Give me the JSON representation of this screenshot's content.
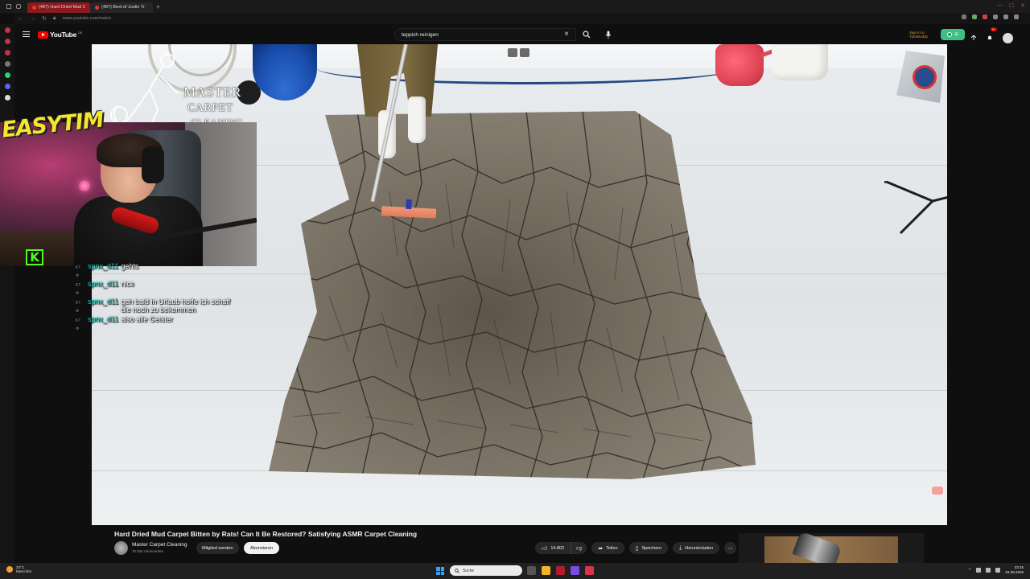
{
  "browser": {
    "tabs": [
      {
        "label": "(487) Hard Dried Mud Ca",
        "active": true
      },
      {
        "label": "(487) Best of Justin Tr",
        "active": false
      }
    ],
    "url": "www.youtube.com/watch"
  },
  "youtube": {
    "logo": "YouTube",
    "logo_country": "DE",
    "search_query": "teppich reinigen",
    "signin_label_1": "Sign in to",
    "signin_label_2": "TubeBuddy",
    "notification_count": "9+"
  },
  "video": {
    "watermark_line1": "MASTER",
    "watermark_line2": "CARPET",
    "watermark_line3": "CLEANING"
  },
  "stream_overlay": {
    "streamer_logo": "EASYTIM",
    "kick_logo": "K",
    "chat": [
      {
        "badges": "KT ⚙",
        "user": "spnx_d11",
        "message": "gehts"
      },
      {
        "badges": "KT ⚙",
        "user": "spnx_d11",
        "message": "nice"
      },
      {
        "badges": "KT ⚙",
        "user": "spnx_d11",
        "message": "geh bald in Urlaub hoffe ich schaff die noch zu bekommen"
      },
      {
        "badges": "KT ⚙",
        "user": "spnx_d11",
        "message": "also alle Geister"
      }
    ]
  },
  "video_info": {
    "title": "Hard Dried Mud Carpet Bitten by Rats! Can It Be Restored? Satisfying ASMR Carpet Cleaning",
    "channel_name": "Master Carpet Cleaning",
    "subscribers": "76.500 Abonnenten",
    "member_button": "Mitglied werden",
    "subscribe_button": "Abonnieren",
    "likes": "14.802",
    "share_button": "Teilen",
    "save_button": "Speichern",
    "download_button": "Herunterladen"
  },
  "taskbar": {
    "weather_temp": "23°C",
    "weather_desc": "Meist klar",
    "search_placeholder": "Suche",
    "time": "23:15",
    "date": "04.06.2026"
  }
}
